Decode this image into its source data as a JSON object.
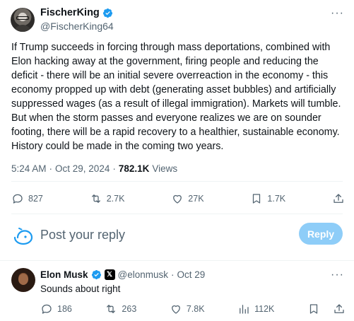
{
  "tweet": {
    "author": {
      "name": "FischerKing",
      "handle": "@FischerKing64"
    },
    "text": "If Trump succeeds in forcing through mass deportations, combined with Elon hacking away at the government, firing people and reducing the deficit - there will be an initial severe overreaction in the economy - this economy propped up with debt (generating asset bubbles) and artificially suppressed wages (as a result of illegal immigration). Markets will tumble. But when the storm passes and everyone realizes we are on sounder footing, there will be a rapid recovery to a healthier, sustainable economy. History could be made in the coming two years.",
    "time": "5:24 AM",
    "dot": "·",
    "date": "Oct 29, 2024",
    "views_count": "782.1K",
    "views_label": "Views",
    "actions": {
      "replies": "827",
      "reposts": "2.7K",
      "likes": "27K",
      "bookmarks": "1.7K"
    },
    "more_label": "···"
  },
  "reply_box": {
    "placeholder": "Post your reply",
    "button_label": "Reply"
  },
  "reply": {
    "author": {
      "name": "Elon Musk",
      "handle": "@elonmusk",
      "affiliate_mark": "𝕏"
    },
    "dot": "·",
    "date": "Oct 29",
    "text": "Sounds about right",
    "actions": {
      "replies": "186",
      "reposts": "263",
      "likes": "7.8K",
      "views": "112K"
    },
    "more_label": "···"
  },
  "colors": {
    "verified": "#1d9bf0",
    "muted_text": "#536471",
    "reply_button_bg": "#8ecdf8",
    "divider": "#eff3f4"
  },
  "icons": [
    "verified-badge-icon",
    "more-icon",
    "reply-icon",
    "repost-icon",
    "like-icon",
    "bookmark-icon",
    "share-icon",
    "views-icon",
    "compose-bubble-icon"
  ]
}
